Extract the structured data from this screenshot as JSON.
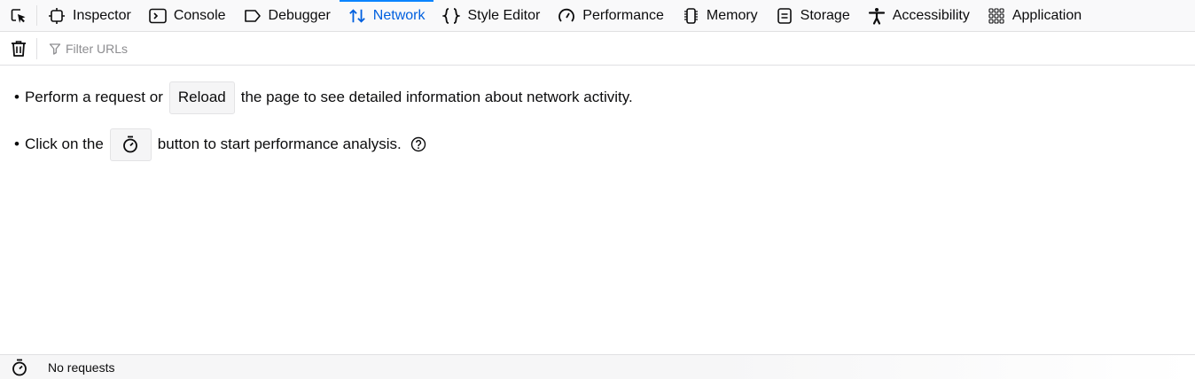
{
  "tabs": [
    {
      "label": "Inspector",
      "icon": "inspector-icon"
    },
    {
      "label": "Console",
      "icon": "console-icon"
    },
    {
      "label": "Debugger",
      "icon": "debugger-icon"
    },
    {
      "label": "Network",
      "icon": "network-icon",
      "selected": true
    },
    {
      "label": "Style Editor",
      "icon": "style-editor-icon"
    },
    {
      "label": "Performance",
      "icon": "performance-icon"
    },
    {
      "label": "Memory",
      "icon": "memory-icon"
    },
    {
      "label": "Storage",
      "icon": "storage-icon"
    },
    {
      "label": "Accessibility",
      "icon": "accessibility-icon"
    },
    {
      "label": "Application",
      "icon": "application-icon"
    }
  ],
  "filter": {
    "placeholder": "Filter URLs",
    "value": ""
  },
  "notice": {
    "line1_before": "Perform a request or",
    "reload_label": "Reload",
    "line1_after": "the page to see detailed information about network activity.",
    "line2_before": "Click on the",
    "line2_after": "button to start performance analysis."
  },
  "status": {
    "text": "No requests"
  },
  "colors": {
    "accent": "#0a84ff",
    "selected_text": "#0060df",
    "border": "#e0e0e2"
  }
}
